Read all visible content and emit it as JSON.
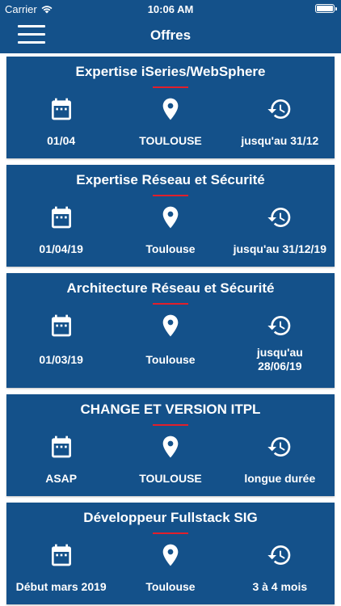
{
  "status": {
    "carrier": "Carrier",
    "time": "10:06 AM"
  },
  "header": {
    "title": "Offres"
  },
  "colors": {
    "header_bg": "#14518a",
    "card_bg": "#14518a",
    "accent_red": "#e21f2b"
  },
  "icons": {
    "menu": "hamburger-icon",
    "date": "calendar-icon",
    "location": "map-pin-icon",
    "duration": "history-icon"
  },
  "offers": [
    {
      "title": "Expertise iSeries/WebSphere",
      "start": "01/04",
      "location": "TOULOUSE",
      "duration": "jusqu'au 31/12"
    },
    {
      "title": "Expertise Réseau et Sécurité",
      "start": "01/04/19",
      "location": "Toulouse",
      "duration": "jusqu'au 31/12/19"
    },
    {
      "title": "Architecture Réseau et Sécurité",
      "start": "01/03/19",
      "location": "Toulouse",
      "duration": "jusqu'au 28/06/19"
    },
    {
      "title": "CHANGE ET VERSION ITPL",
      "start": "ASAP",
      "location": "TOULOUSE",
      "duration": "longue durée"
    },
    {
      "title": "Développeur Fullstack SIG",
      "start": "Début mars 2019",
      "location": "Toulouse",
      "duration": "3 à 4 mois"
    }
  ]
}
